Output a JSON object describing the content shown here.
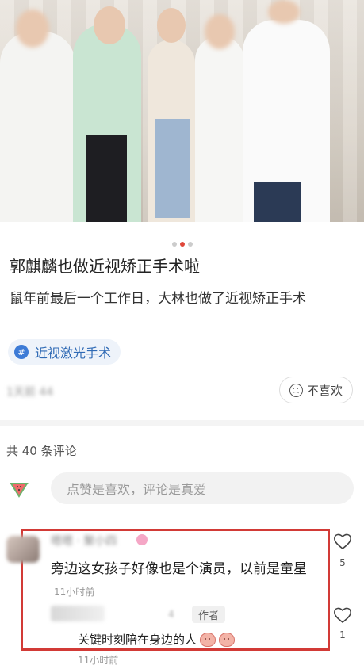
{
  "post": {
    "title": "郭麒麟也做近视矫正手术啦",
    "description": "鼠年前最后一个工作日，大林也做了近视矫正手术",
    "tag": "近视激光手术",
    "meta_blurred": "1天前 44",
    "dislike_label": "不喜欢",
    "carousel": {
      "total": 3,
      "active": 2
    }
  },
  "comments": {
    "count_label": "共 40 条评论",
    "input_placeholder": "点赞是喜欢，评论是真爱",
    "items": [
      {
        "username_blurred": "嗯嗯 · 聚小四",
        "text": "旁边这女孩子好像也是个演员，以前是童星",
        "time": "11小时前",
        "likes": "5",
        "reply": {
          "username_blurred": "糖豆",
          "badge_blurred": "4",
          "author_badge": "作者",
          "text": "关键时刻陪在身边的人",
          "time": "11小时前",
          "likes": "1"
        }
      }
    ]
  },
  "colors": {
    "accent_red": "#d23a36",
    "tag_blue": "#2f6ab5"
  }
}
